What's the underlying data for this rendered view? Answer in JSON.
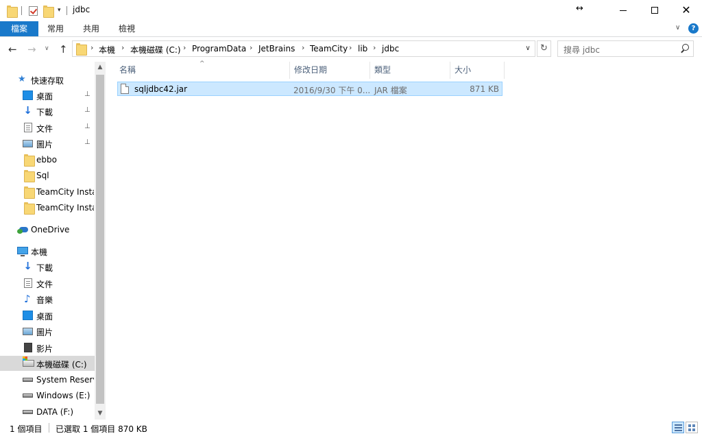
{
  "window": {
    "title": "jdbc",
    "resize_glyph": "↔",
    "minimize_glyph": "",
    "maximize_glyph": "",
    "close_glyph": "✕"
  },
  "ribbon": {
    "file_tab": "檔案",
    "tabs": [
      "常用",
      "共用",
      "檢視"
    ],
    "collapse_glyph": "∨",
    "help_glyph": "?"
  },
  "nav_buttons": {
    "back": "←",
    "forward": "→",
    "recent": "∨",
    "up": "↑"
  },
  "address": {
    "crumbs": [
      "本機",
      "本機磁碟 (C:)",
      "ProgramData",
      "JetBrains",
      "TeamCity",
      "lib",
      "jdbc"
    ],
    "separator": "›",
    "dropdown_glyph": "∨",
    "refresh_glyph": "↻"
  },
  "search": {
    "placeholder": "搜尋 jdbc"
  },
  "nav_pane": {
    "quick_access": "快速存取",
    "quick_items": [
      {
        "label": "桌面",
        "icon": "desktop-icon",
        "pinned": true
      },
      {
        "label": "下載",
        "icon": "download-icon",
        "pinned": true
      },
      {
        "label": "文件",
        "icon": "document-icon",
        "pinned": true
      },
      {
        "label": "圖片",
        "icon": "pictures-icon",
        "pinned": true
      },
      {
        "label": "ebbo",
        "icon": "folder-icon",
        "pinned": false
      },
      {
        "label": "Sql",
        "icon": "folder-icon",
        "pinned": false
      },
      {
        "label": "TeamCity Instal",
        "icon": "folder-icon",
        "pinned": false
      },
      {
        "label": "TeamCity Instal",
        "icon": "folder-icon",
        "pinned": false
      }
    ],
    "onedrive": "OneDrive",
    "this_pc": "本機",
    "pc_items": [
      {
        "label": "下載",
        "icon": "download-icon"
      },
      {
        "label": "文件",
        "icon": "document-icon"
      },
      {
        "label": "音樂",
        "icon": "music-icon"
      },
      {
        "label": "桌面",
        "icon": "desktop-icon"
      },
      {
        "label": "圖片",
        "icon": "pictures-icon"
      },
      {
        "label": "影片",
        "icon": "video-icon"
      },
      {
        "label": "本機磁碟 (C:)",
        "icon": "system-drive-icon",
        "selected": true
      },
      {
        "label": "System Reserve",
        "icon": "drive-icon"
      },
      {
        "label": "Windows (E:)",
        "icon": "drive-icon"
      },
      {
        "label": "DATA (F:)",
        "icon": "drive-icon"
      }
    ],
    "scroll_up": "▲",
    "scroll_down": "▼",
    "pin_glyph": "📌"
  },
  "file_list": {
    "columns": [
      "名稱",
      "修改日期",
      "類型",
      "大小"
    ],
    "sort_glyph": "^",
    "rows": [
      {
        "name": "sqljdbc42.jar",
        "modified": "2016/9/30 下午 0...",
        "type": "JAR 檔案",
        "size": "871 KB"
      }
    ]
  },
  "status": {
    "item_count": "1 個項目",
    "selected": "已選取 1 個項目 870 KB"
  },
  "colors": {
    "accent": "#1979ca",
    "selection": "#cce8ff",
    "selection_border": "#99d1ff"
  }
}
